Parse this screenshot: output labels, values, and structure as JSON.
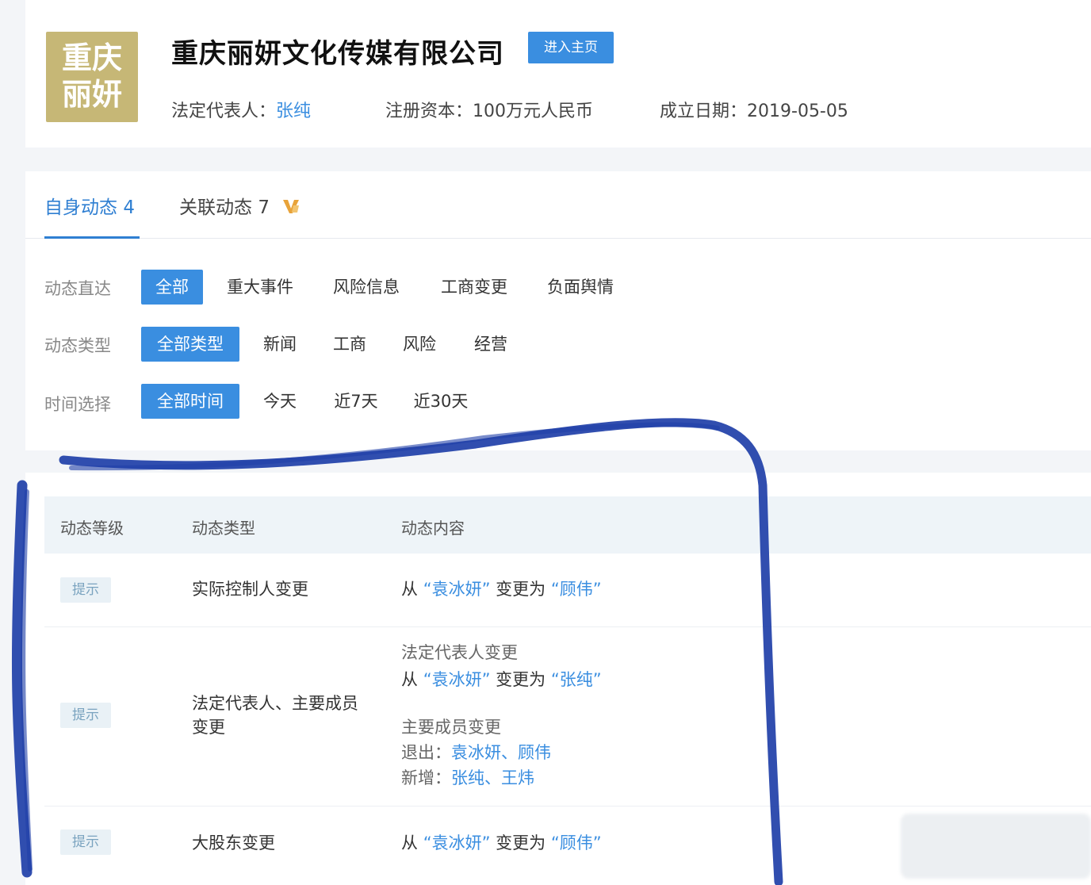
{
  "company": {
    "logo_line1": "重庆",
    "logo_line2": "丽妍",
    "name": "重庆丽妍文化传媒有限公司",
    "enter_home_label": "进入主页",
    "legal_rep_label": "法定代表人：",
    "legal_rep_value": "张纯",
    "capital_label": "注册资本：",
    "capital_value": "100万元人民币",
    "founded_label": "成立日期：",
    "founded_value": "2019-05-05"
  },
  "tabs": [
    {
      "label": "自身动态",
      "count": "4"
    },
    {
      "label": "关联动态",
      "count": "7"
    }
  ],
  "filters": {
    "direct": {
      "label": "动态直达",
      "options": [
        "全部",
        "重大事件",
        "风险信息",
        "工商变更",
        "负面舆情"
      ]
    },
    "type": {
      "label": "动态类型",
      "options": [
        "全部类型",
        "新闻",
        "工商",
        "风险",
        "经营"
      ]
    },
    "time": {
      "label": "时间选择",
      "options": [
        "全部时间",
        "今天",
        "近7天",
        "近30天"
      ]
    }
  },
  "table": {
    "headers": [
      "动态等级",
      "动态类型",
      "动态内容"
    ],
    "rows": [
      {
        "level": "提示",
        "type": "实际控制人变更",
        "content": {
          "prefix": "从",
          "from": "“袁冰妍”",
          "mid": "变更为",
          "to": "“顾伟”"
        }
      },
      {
        "level": "提示",
        "type_line1": "法定代表人、主要成员",
        "type_line2": "变更",
        "content": {
          "title1": "法定代表人变更",
          "prefix": "从",
          "from": "“袁冰妍”",
          "mid": "变更为",
          "to": "“张纯”",
          "title2": "主要成员变更",
          "exit_label": "退出：",
          "exit_value": "袁冰妍、顾伟",
          "new_label": "新增：",
          "new_value": "张纯、王炜"
        }
      },
      {
        "level": "提示",
        "type": "大股东变更",
        "content": {
          "prefix": "从",
          "from": "“袁冰妍”",
          "mid": "变更为",
          "to": "“顾伟”"
        }
      }
    ]
  },
  "colors": {
    "accent": "#3a8ee0",
    "logo_bg": "#c6b776",
    "scribble": "#1f3fa8"
  }
}
